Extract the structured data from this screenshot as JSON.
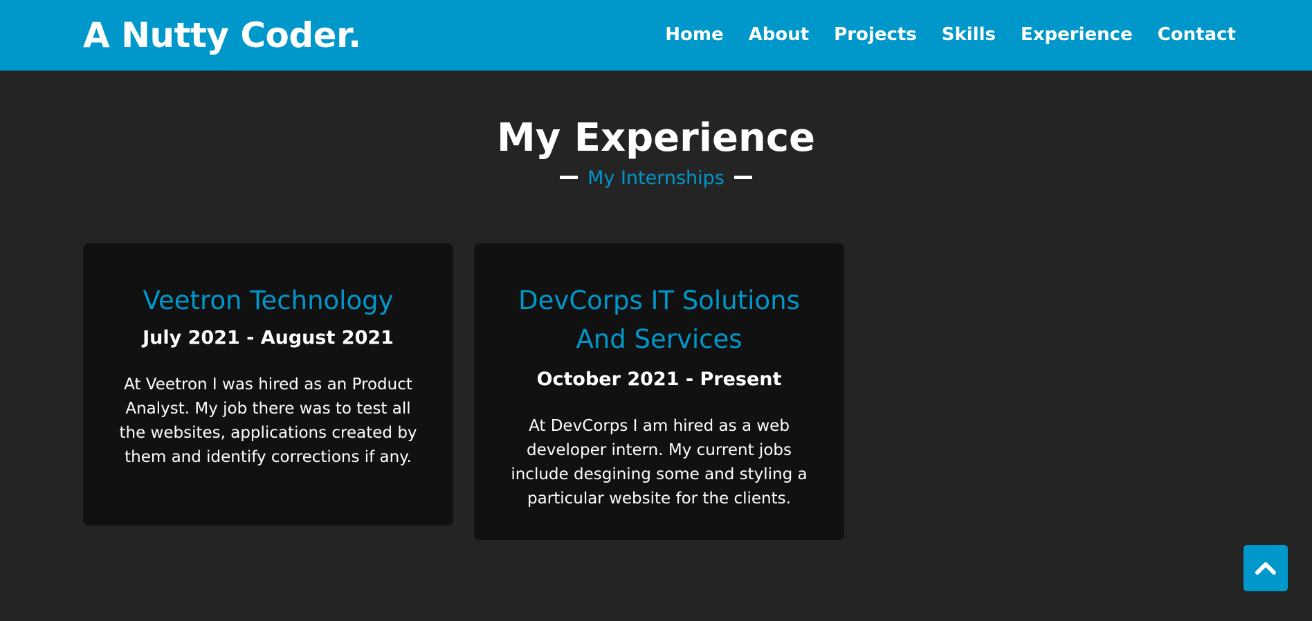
{
  "header": {
    "logo": "A Nutty Coder.",
    "nav": [
      "Home",
      "About",
      "Projects",
      "Skills",
      "Experience",
      "Contact"
    ]
  },
  "experience": {
    "title": "My Experience",
    "subtitle": "My Internships",
    "cards": [
      {
        "company": "Veetron Technology",
        "period": "July 2021 - August 2021",
        "description": "At Veetron I was hired as an Product Analyst. My job there was to test all the websites, applications created by them and identify corrections if any."
      },
      {
        "company": "DevCorps IT Solutions And Services",
        "period": "October 2021 - Present",
        "description": "At DevCorps I am hired as a web developer intern. My current jobs include desgining some and styling a particular website for the clients."
      }
    ]
  },
  "scroll_top": {
    "icon": "chevron-up-icon"
  },
  "colors": {
    "accent": "#0097cb",
    "background": "#242424",
    "card": "#111111",
    "text": "#ffffff"
  }
}
